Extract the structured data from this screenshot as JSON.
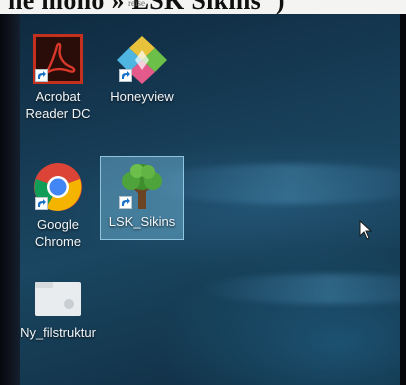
{
  "document_header": {
    "caption": "ne mono » LSK Sikins\")",
    "small_text": "reise"
  },
  "desktop": {
    "icons": [
      {
        "label_lines": [
          "Acrobat",
          "Reader DC"
        ],
        "icon": "acrobat-reader-icon"
      },
      {
        "label_lines": [
          "Honeyview"
        ],
        "icon": "honeyview-icon"
      },
      {
        "label_lines": [
          "Google",
          "Chrome"
        ],
        "icon": "chrome-icon"
      },
      {
        "label_lines": [
          "LSK_Sikins"
        ],
        "icon": "tree-icon",
        "selected": true
      },
      {
        "label_lines": [
          "Ny_filstruktur"
        ],
        "icon": "folder-icon"
      }
    ]
  },
  "colors": {
    "acrobat_bg": "#c4301e",
    "selection": "#78bee1",
    "desktop_bg": "#173d57"
  }
}
